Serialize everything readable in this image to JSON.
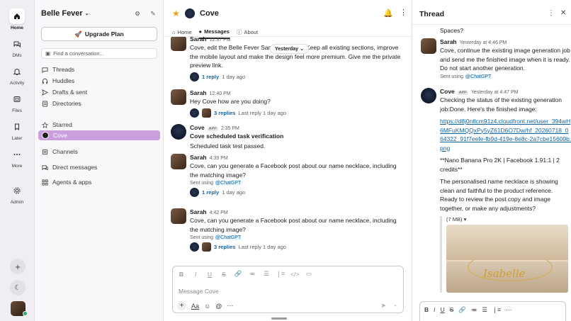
{
  "rail": {
    "items": [
      {
        "label": "Home",
        "icon": "home-icon"
      },
      {
        "label": "DMs",
        "icon": "dms-icon"
      },
      {
        "label": "Activity",
        "icon": "bell-icon"
      },
      {
        "label": "Files",
        "icon": "files-icon"
      },
      {
        "label": "Later",
        "icon": "bookmark-icon"
      },
      {
        "label": "More",
        "icon": "more-icon"
      },
      {
        "label": "Admin",
        "icon": "gear-icon"
      }
    ]
  },
  "sidebar": {
    "workspace_name": "Belle Fever",
    "upgrade_label": "Upgrade Plan",
    "find_placeholder": "Find a conversation...",
    "nav": [
      "Threads",
      "Huddles",
      "Drafts & sent",
      "Directories"
    ],
    "starred_label": "Starred",
    "starred_channel": "Cove",
    "sections": [
      "Channels",
      "Direct messages",
      "Agents & apps"
    ]
  },
  "channel": {
    "name": "Cove",
    "tabs": [
      "Home",
      "Messages",
      "About"
    ],
    "date_pill": "Yesterday",
    "composer_placeholder": "Message Cove"
  },
  "messages": [
    {
      "name": "Sarah",
      "time": "12:37 PM",
      "text": "Cove, edit the Belle Fever Sandbox HTML. Keep all existing sections, improve the mobile layout and make the design feel more premium. Give me the private preview link.",
      "reply_label": "1 reply",
      "reply_meta": "1 day ago"
    },
    {
      "name": "Sarah",
      "time": "12:40 PM",
      "text": "Hey Cove how are you doing?",
      "reply_label": "3 replies",
      "reply_meta": "Last reply 1 day ago"
    },
    {
      "name": "Cove",
      "app_tag": "APP",
      "time": "2:35 PM",
      "title": "Cove scheduled task verification",
      "text": "Scheduled task test passed."
    },
    {
      "name": "Sarah",
      "time": "4:39 PM",
      "text": "Cove, can you generate a Facebook post about our name necklace, including the matching image?",
      "sent_using": "Sent using",
      "mention": "@ChatGPT",
      "reply_label": "1 reply",
      "reply_meta": "1 day ago"
    },
    {
      "name": "Sarah",
      "time": "4:42 PM",
      "text": "Cove, can you generate a Facebook post about our name necklace, including the matching image?",
      "sent_using": "Sent using",
      "mention": "@ChatGPT",
      "reply_label": "3 replies",
      "reply_meta": "Last reply 1 day ago"
    }
  ],
  "thread": {
    "title": "Thread",
    "top_text": "Spaces?",
    "messages": [
      {
        "name": "Sarah",
        "time": "Yesterday at 4:46 PM",
        "text": "Cove, continue the existing image generation job and send me the finished image when it is ready. Do not start another generation.",
        "sent_using": "Sent using",
        "mention": "@ChatGPT"
      },
      {
        "name": "Cove",
        "app_tag": "APP",
        "time": "Yesterday at 4:47 PM",
        "text": "Checking the status of the existing generation job:Done. Here's the finished image:",
        "link": "https://d8j0ntlcm91z4.cloudfront.net/user_394wH6MFuKMQQxPy5yZ61D6O7Dw/hf_20260718_064322_91f7eefe-fb9d-419e-8e8c-2a7cbe15609b.png",
        "model_line": "**Nano Banana Pro 2K | Facebook 1.91:1 | 2 credits**",
        "follow_text": "The personalised name necklace is showing clean and faithful to the product reference. Ready to review the post copy and image together, or make any adjustments?",
        "attachment_label": "(7 MB)",
        "pendant_text": "Isabelle"
      }
    ]
  }
}
